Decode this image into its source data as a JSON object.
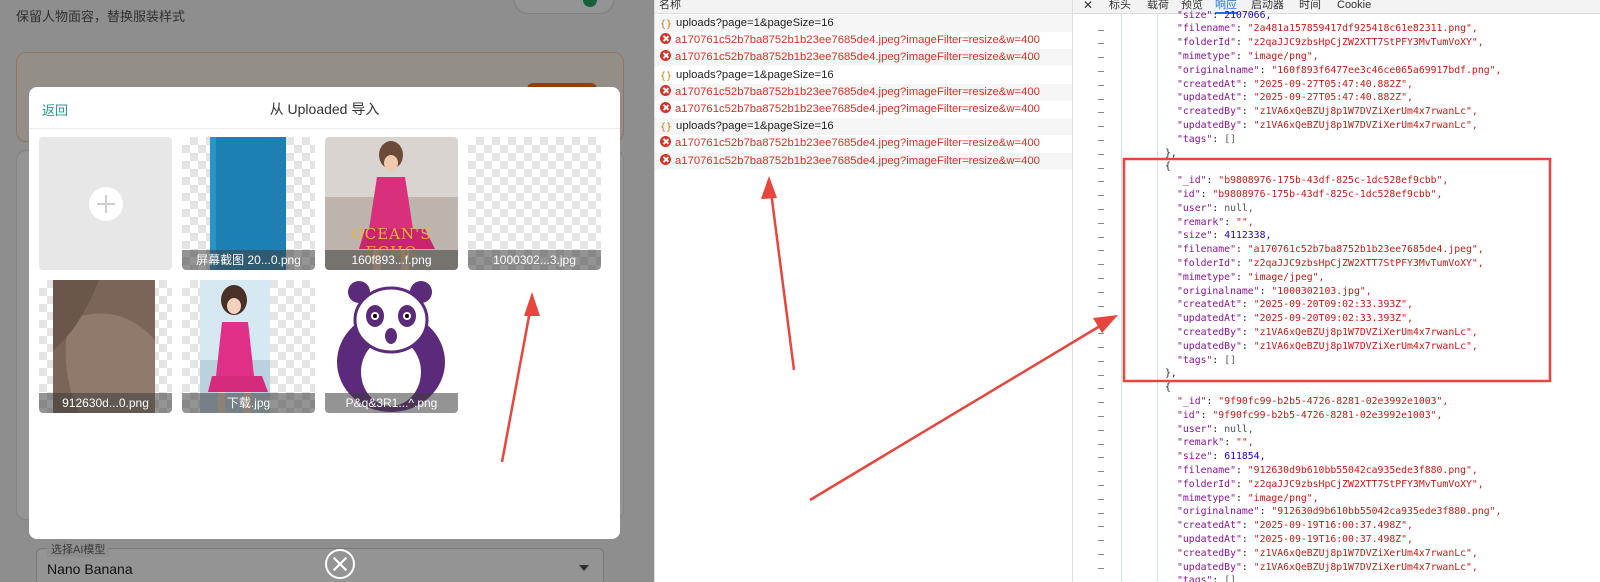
{
  "app": {
    "subtitle": "保留人物面容，替换服装样式",
    "model_select": {
      "label": "选择AI模型",
      "value": "Nano Banana"
    }
  },
  "modal": {
    "back_label": "返回",
    "title": "从 Uploaded 导入",
    "thumbnails": [
      {
        "caption": "屏幕截图 20...0.png"
      },
      {
        "caption": "160f893...f.png",
        "poster_text": "OCEAN'S ECHO"
      },
      {
        "caption": "1000302...3.jpg"
      },
      {
        "caption": "912630d...0.png"
      },
      {
        "caption": "下载.jpg"
      },
      {
        "caption": "P&q&3R1...^.png"
      }
    ]
  },
  "network": {
    "header": "名称",
    "rows": [
      {
        "type": "xhr",
        "name": "uploads?page=1&pageSize=16"
      },
      {
        "type": "error",
        "name": "a170761c52b7ba8752b1b23ee7685de4.jpeg?imageFilter=resize&w=400"
      },
      {
        "type": "error",
        "name": "a170761c52b7ba8752b1b23ee7685de4.jpeg?imageFilter=resize&w=400"
      },
      {
        "type": "xhr",
        "name": "uploads?page=1&pageSize=16"
      },
      {
        "type": "error",
        "name": "a170761c52b7ba8752b1b23ee7685de4.jpeg?imageFilter=resize&w=400"
      },
      {
        "type": "error",
        "name": "a170761c52b7ba8752b1b23ee7685de4.jpeg?imageFilter=resize&w=400"
      },
      {
        "type": "xhr",
        "name": "uploads?page=1&pageSize=16"
      },
      {
        "type": "error",
        "name": "a170761c52b7ba8752b1b23ee7685de4.jpeg?imageFilter=resize&w=400"
      },
      {
        "type": "error",
        "name": "a170761c52b7ba8752b1b23ee7685de4.jpeg?imageFilter=resize&w=400"
      }
    ]
  },
  "devtools": {
    "close_label": "✕",
    "tabs": [
      "标头",
      "载荷",
      "预览",
      "响应",
      "启动器",
      "时间",
      "Cookie"
    ],
    "active_tab": "响应"
  },
  "response": {
    "lines": [
      "\"size\": 2107066,",
      "\"filename\": \"2a481a157859417df925418c61e82311.png\",",
      "\"folderId\": \"z2qaJJC9zbsHpCjZW2XTT7StPFY3MvTumVoXY\",",
      "\"mimetype\": \"image/png\",",
      "\"originalname\": \"160f893f6477ee3c46ce065a69917bdf.png\",",
      "\"createdAt\": \"2025-09-27T05:47:40.882Z\",",
      "\"updatedAt\": \"2025-09-27T05:47:40.882Z\",",
      "\"createdBy\": \"z1VA6xQeBZUj8p1W7DVZiXerUm4x7rwanLc\",",
      "\"updatedBy\": \"z1VA6xQeBZUj8p1W7DVZiXerUm4x7rwanLc\",",
      "\"tags\": []",
      "},",
      "{",
      "\"_id\": \"b9808976-175b-43df-825c-1dc528ef9cbb\",",
      "\"id\": \"b9808976-175b-43df-825c-1dc528ef9cbb\",",
      "\"user\": null,",
      "\"remark\": \"\",",
      "\"size\": 4112338,",
      "\"filename\": \"a170761c52b7ba8752b1b23ee7685de4.jpeg\",",
      "\"folderId\": \"z2qaJJC9zbsHpCjZW2XTT7StPFY3MvTumVoXY\",",
      "\"mimetype\": \"image/jpeg\",",
      "\"originalname\": \"1000302103.jpg\",",
      "\"createdAt\": \"2025-09-20T09:02:33.393Z\",",
      "\"updatedAt\": \"2025-09-20T09:02:33.393Z\",",
      "\"createdBy\": \"z1VA6xQeBZUj8p1W7DVZiXerUm4x7rwanLc\",",
      "\"updatedBy\": \"z1VA6xQeBZUj8p1W7DVZiXerUm4x7rwanLc\",",
      "\"tags\": []",
      "},",
      "{",
      "\"_id\": \"9f90fc99-b2b5-4726-8281-02e3992e1003\",",
      "\"id\": \"9f90fc99-b2b5-4726-8281-02e3992e1003\",",
      "\"user\": null,",
      "\"remark\": \"\",",
      "\"size\": 611854,",
      "\"filename\": \"912630d9b610bb55042ca935ede3f880.png\",",
      "\"folderId\": \"z2qaJJC9zbsHpCjZW2XTT7StPFY3MvTumVoXY\",",
      "\"mimetype\": \"image/png\",",
      "\"originalname\": \"912630d9b610bb55042ca935ede3f880.png\",",
      "\"createdAt\": \"2025-09-19T16:00:37.498Z\",",
      "\"updatedAt\": \"2025-09-19T16:00:37.498Z\",",
      "\"createdBy\": \"z1VA6xQeBZUj8p1W7DVZiXerUm4x7rwanLc\",",
      "\"updatedBy\": \"z1VA6xQeBZUj8p1W7DVZiXerUm4x7rwanLc\",",
      "\"tags\": []"
    ]
  },
  "annotations": {
    "color": "#e8453c"
  }
}
